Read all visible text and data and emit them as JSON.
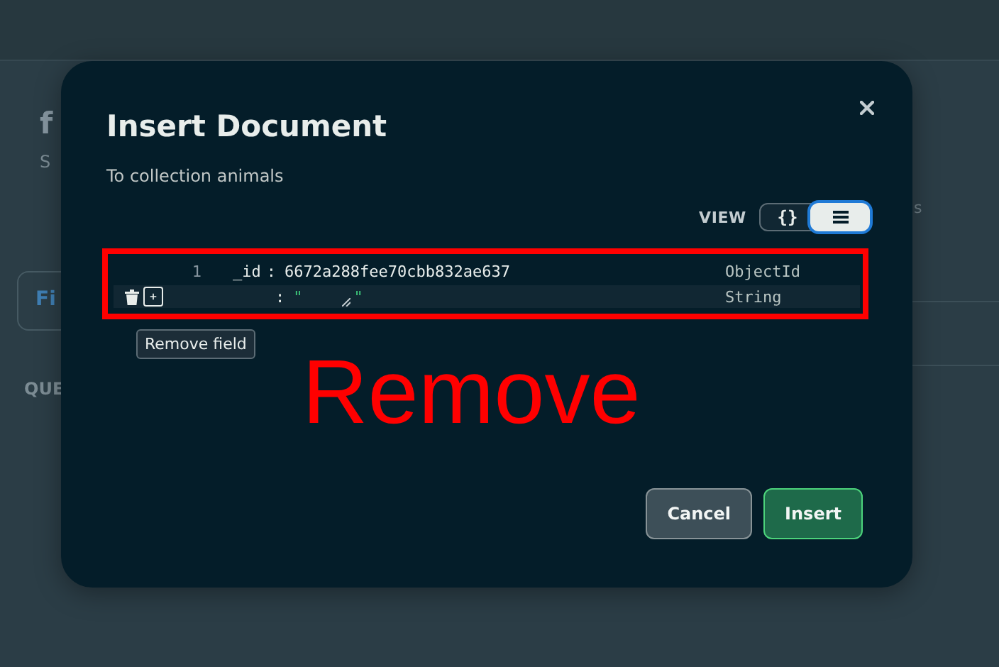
{
  "background": {
    "heading": "f",
    "subheading": "S",
    "filter_field": "Fi",
    "section_label": "QUE",
    "side_text": "s"
  },
  "dialog": {
    "title": "Insert Document",
    "subtitle": "To collection animals",
    "view_label": "VIEW",
    "view_options": [
      {
        "kind": "json",
        "label": "{}",
        "selected": false
      },
      {
        "kind": "list",
        "selected": true
      }
    ],
    "rows": [
      {
        "kind": "objectid",
        "hovered": false,
        "line": "1",
        "key": "_id",
        "separator": ":",
        "value": "6672a288fee70cbb832ae637",
        "type": "ObjectId"
      },
      {
        "kind": "string",
        "hovered": true,
        "separator": ":",
        "open_quote": "\"",
        "close_quote": "\"",
        "type": "String"
      }
    ],
    "tooltip": "Remove field",
    "buttons": [
      {
        "kind": "secondary",
        "label": "Cancel"
      },
      {
        "kind": "primary",
        "label": "Insert"
      }
    ]
  },
  "annotation": {
    "text": "Remove",
    "color": "#ff0000"
  }
}
